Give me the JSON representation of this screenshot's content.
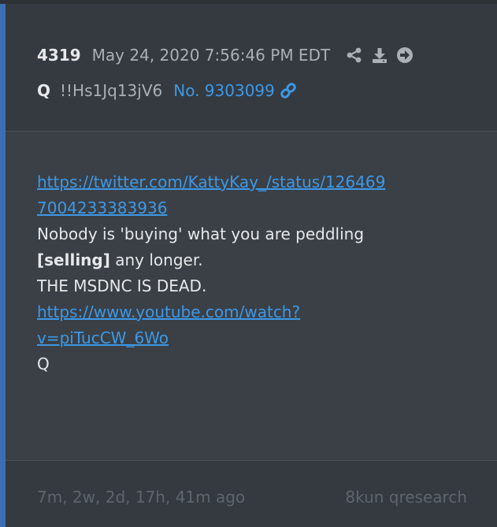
{
  "header": {
    "post_number": "4319",
    "date": "May 24, 2020 7:56:46 PM EDT",
    "author": "Q",
    "tripcode": "!!Hs1Jq13jV6",
    "post_link": "No. 9303099",
    "icons": [
      "share-icon",
      "download-icon",
      "arrow-right-circle-icon",
      "link-icon"
    ]
  },
  "body": {
    "link1_line1": "https://twitter.com/KattyKay_/status/126469",
    "link1_line2": "7004233383936",
    "line1": "Nobody is 'buying' what you are peddling",
    "line2_bold": "[selling]",
    "line2_rest": " any longer.",
    "line3": "THE MSDNC IS DEAD.",
    "link2_line1": "https://www.youtube.com/watch?",
    "link2_line2": "v=piTucCW_6Wo",
    "signature": "Q"
  },
  "footer": {
    "ago": "7m, 2w, 2d, 17h, 41m ago",
    "source": "8kun qresearch"
  },
  "colors": {
    "accent": "#3a6fb3",
    "link": "#3e98e6",
    "background": "#343a40"
  }
}
